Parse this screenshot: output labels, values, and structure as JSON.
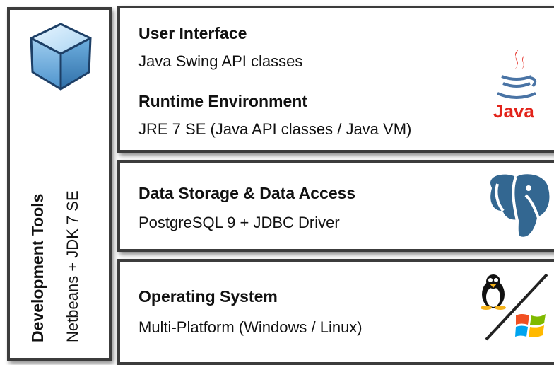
{
  "sidebar": {
    "tool_title": "Development Tools",
    "tool_subtitle": "Netbeans + JDK 7 SE",
    "icon": "netbeans-cube-icon"
  },
  "layers": {
    "ui": {
      "title": "User Interface",
      "subtitle": "Java Swing API classes",
      "runtime_title": "Runtime Environment",
      "runtime_subtitle": "JRE 7 SE (Java API classes / Java VM)",
      "icon": "java-icon",
      "icon_text": "Java"
    },
    "data": {
      "title": "Data Storage & Data Access",
      "subtitle": "PostgreSQL 9 + JDBC Driver",
      "icon": "postgresql-elephant-icon"
    },
    "os": {
      "title": "Operating System",
      "subtitle": "Multi-Platform (Windows / Linux)",
      "icons": [
        "linux-penguin-icon",
        "windows-logo-icon"
      ]
    }
  },
  "colors": {
    "border": "#3c3c3c",
    "java_red": "#e2231a",
    "java_blue": "#4a74a5",
    "postgres_blue": "#336791",
    "cube_blue": "#8fc3ea"
  }
}
